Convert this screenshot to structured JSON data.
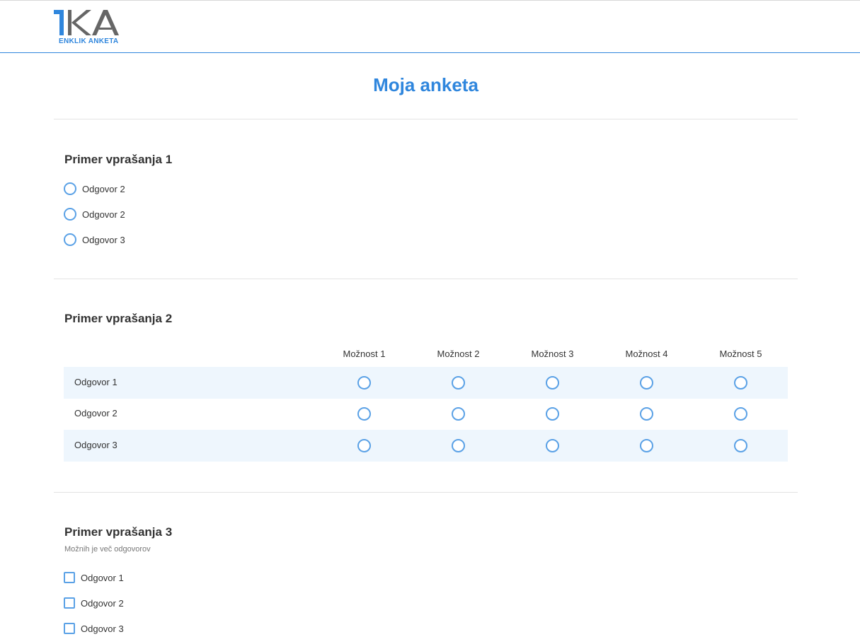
{
  "header": {
    "logo_mark": "1KA",
    "logo_subtitle": "ENKLIK ANKETA",
    "colors": {
      "accent": "#2f86dd",
      "logo_gray": "#666666"
    }
  },
  "survey": {
    "title": "Moja anketa"
  },
  "questions": [
    {
      "title": "Primer vprašanja 1",
      "type": "radio",
      "options": [
        "Odgovor 2",
        "Odgovor 2",
        "Odgovor 3"
      ]
    },
    {
      "title": "Primer vprašanja 2",
      "type": "matrix",
      "columns": [
        "Možnost 1",
        "Možnost 2",
        "Možnost 3",
        "Možnost 4",
        "Možnost 5"
      ],
      "rows": [
        "Odgovor 1",
        "Odgovor 2",
        "Odgovor 3"
      ]
    },
    {
      "title": "Primer vprašanja 3",
      "hint": "Možnih je več odgovorov",
      "type": "checkbox",
      "options": [
        "Odgovor 1",
        "Odgovor 2",
        "Odgovor 3"
      ]
    }
  ]
}
